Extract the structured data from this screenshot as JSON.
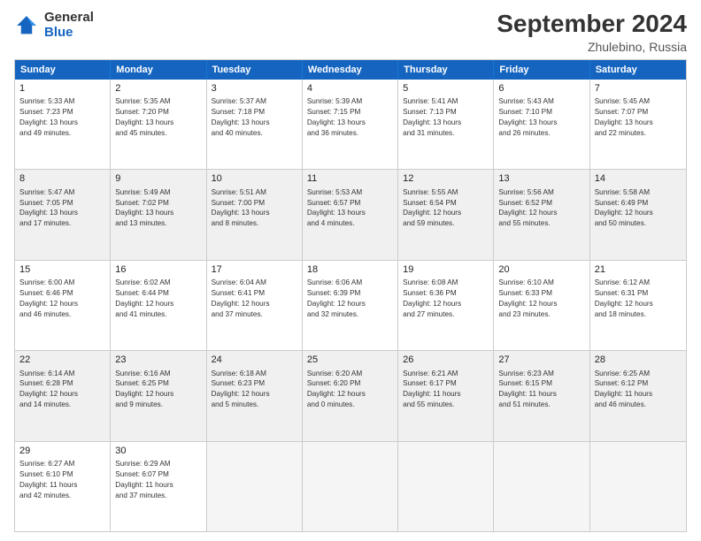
{
  "logo": {
    "general": "General",
    "blue": "Blue"
  },
  "header": {
    "month_year": "September 2024",
    "location": "Zhulebino, Russia"
  },
  "weekdays": [
    "Sunday",
    "Monday",
    "Tuesday",
    "Wednesday",
    "Thursday",
    "Friday",
    "Saturday"
  ],
  "rows": [
    [
      {
        "day": "1",
        "lines": [
          "Sunrise: 5:33 AM",
          "Sunset: 7:23 PM",
          "Daylight: 13 hours",
          "and 49 minutes."
        ],
        "shaded": false
      },
      {
        "day": "2",
        "lines": [
          "Sunrise: 5:35 AM",
          "Sunset: 7:20 PM",
          "Daylight: 13 hours",
          "and 45 minutes."
        ],
        "shaded": false
      },
      {
        "day": "3",
        "lines": [
          "Sunrise: 5:37 AM",
          "Sunset: 7:18 PM",
          "Daylight: 13 hours",
          "and 40 minutes."
        ],
        "shaded": false
      },
      {
        "day": "4",
        "lines": [
          "Sunrise: 5:39 AM",
          "Sunset: 7:15 PM",
          "Daylight: 13 hours",
          "and 36 minutes."
        ],
        "shaded": false
      },
      {
        "day": "5",
        "lines": [
          "Sunrise: 5:41 AM",
          "Sunset: 7:13 PM",
          "Daylight: 13 hours",
          "and 31 minutes."
        ],
        "shaded": false
      },
      {
        "day": "6",
        "lines": [
          "Sunrise: 5:43 AM",
          "Sunset: 7:10 PM",
          "Daylight: 13 hours",
          "and 26 minutes."
        ],
        "shaded": false
      },
      {
        "day": "7",
        "lines": [
          "Sunrise: 5:45 AM",
          "Sunset: 7:07 PM",
          "Daylight: 13 hours",
          "and 22 minutes."
        ],
        "shaded": false
      }
    ],
    [
      {
        "day": "8",
        "lines": [
          "Sunrise: 5:47 AM",
          "Sunset: 7:05 PM",
          "Daylight: 13 hours",
          "and 17 minutes."
        ],
        "shaded": true
      },
      {
        "day": "9",
        "lines": [
          "Sunrise: 5:49 AM",
          "Sunset: 7:02 PM",
          "Daylight: 13 hours",
          "and 13 minutes."
        ],
        "shaded": true
      },
      {
        "day": "10",
        "lines": [
          "Sunrise: 5:51 AM",
          "Sunset: 7:00 PM",
          "Daylight: 13 hours",
          "and 8 minutes."
        ],
        "shaded": true
      },
      {
        "day": "11",
        "lines": [
          "Sunrise: 5:53 AM",
          "Sunset: 6:57 PM",
          "Daylight: 13 hours",
          "and 4 minutes."
        ],
        "shaded": true
      },
      {
        "day": "12",
        "lines": [
          "Sunrise: 5:55 AM",
          "Sunset: 6:54 PM",
          "Daylight: 12 hours",
          "and 59 minutes."
        ],
        "shaded": true
      },
      {
        "day": "13",
        "lines": [
          "Sunrise: 5:56 AM",
          "Sunset: 6:52 PM",
          "Daylight: 12 hours",
          "and 55 minutes."
        ],
        "shaded": true
      },
      {
        "day": "14",
        "lines": [
          "Sunrise: 5:58 AM",
          "Sunset: 6:49 PM",
          "Daylight: 12 hours",
          "and 50 minutes."
        ],
        "shaded": true
      }
    ],
    [
      {
        "day": "15",
        "lines": [
          "Sunrise: 6:00 AM",
          "Sunset: 6:46 PM",
          "Daylight: 12 hours",
          "and 46 minutes."
        ],
        "shaded": false
      },
      {
        "day": "16",
        "lines": [
          "Sunrise: 6:02 AM",
          "Sunset: 6:44 PM",
          "Daylight: 12 hours",
          "and 41 minutes."
        ],
        "shaded": false
      },
      {
        "day": "17",
        "lines": [
          "Sunrise: 6:04 AM",
          "Sunset: 6:41 PM",
          "Daylight: 12 hours",
          "and 37 minutes."
        ],
        "shaded": false
      },
      {
        "day": "18",
        "lines": [
          "Sunrise: 6:06 AM",
          "Sunset: 6:39 PM",
          "Daylight: 12 hours",
          "and 32 minutes."
        ],
        "shaded": false
      },
      {
        "day": "19",
        "lines": [
          "Sunrise: 6:08 AM",
          "Sunset: 6:36 PM",
          "Daylight: 12 hours",
          "and 27 minutes."
        ],
        "shaded": false
      },
      {
        "day": "20",
        "lines": [
          "Sunrise: 6:10 AM",
          "Sunset: 6:33 PM",
          "Daylight: 12 hours",
          "and 23 minutes."
        ],
        "shaded": false
      },
      {
        "day": "21",
        "lines": [
          "Sunrise: 6:12 AM",
          "Sunset: 6:31 PM",
          "Daylight: 12 hours",
          "and 18 minutes."
        ],
        "shaded": false
      }
    ],
    [
      {
        "day": "22",
        "lines": [
          "Sunrise: 6:14 AM",
          "Sunset: 6:28 PM",
          "Daylight: 12 hours",
          "and 14 minutes."
        ],
        "shaded": true
      },
      {
        "day": "23",
        "lines": [
          "Sunrise: 6:16 AM",
          "Sunset: 6:25 PM",
          "Daylight: 12 hours",
          "and 9 minutes."
        ],
        "shaded": true
      },
      {
        "day": "24",
        "lines": [
          "Sunrise: 6:18 AM",
          "Sunset: 6:23 PM",
          "Daylight: 12 hours",
          "and 5 minutes."
        ],
        "shaded": true
      },
      {
        "day": "25",
        "lines": [
          "Sunrise: 6:20 AM",
          "Sunset: 6:20 PM",
          "Daylight: 12 hours",
          "and 0 minutes."
        ],
        "shaded": true
      },
      {
        "day": "26",
        "lines": [
          "Sunrise: 6:21 AM",
          "Sunset: 6:17 PM",
          "Daylight: 11 hours",
          "and 55 minutes."
        ],
        "shaded": true
      },
      {
        "day": "27",
        "lines": [
          "Sunrise: 6:23 AM",
          "Sunset: 6:15 PM",
          "Daylight: 11 hours",
          "and 51 minutes."
        ],
        "shaded": true
      },
      {
        "day": "28",
        "lines": [
          "Sunrise: 6:25 AM",
          "Sunset: 6:12 PM",
          "Daylight: 11 hours",
          "and 46 minutes."
        ],
        "shaded": true
      }
    ],
    [
      {
        "day": "29",
        "lines": [
          "Sunrise: 6:27 AM",
          "Sunset: 6:10 PM",
          "Daylight: 11 hours",
          "and 42 minutes."
        ],
        "shaded": false
      },
      {
        "day": "30",
        "lines": [
          "Sunrise: 6:29 AM",
          "Sunset: 6:07 PM",
          "Daylight: 11 hours",
          "and 37 minutes."
        ],
        "shaded": false
      },
      {
        "day": "",
        "lines": [],
        "shaded": false,
        "empty": true
      },
      {
        "day": "",
        "lines": [],
        "shaded": false,
        "empty": true
      },
      {
        "day": "",
        "lines": [],
        "shaded": false,
        "empty": true
      },
      {
        "day": "",
        "lines": [],
        "shaded": false,
        "empty": true
      },
      {
        "day": "",
        "lines": [],
        "shaded": false,
        "empty": true
      }
    ]
  ]
}
